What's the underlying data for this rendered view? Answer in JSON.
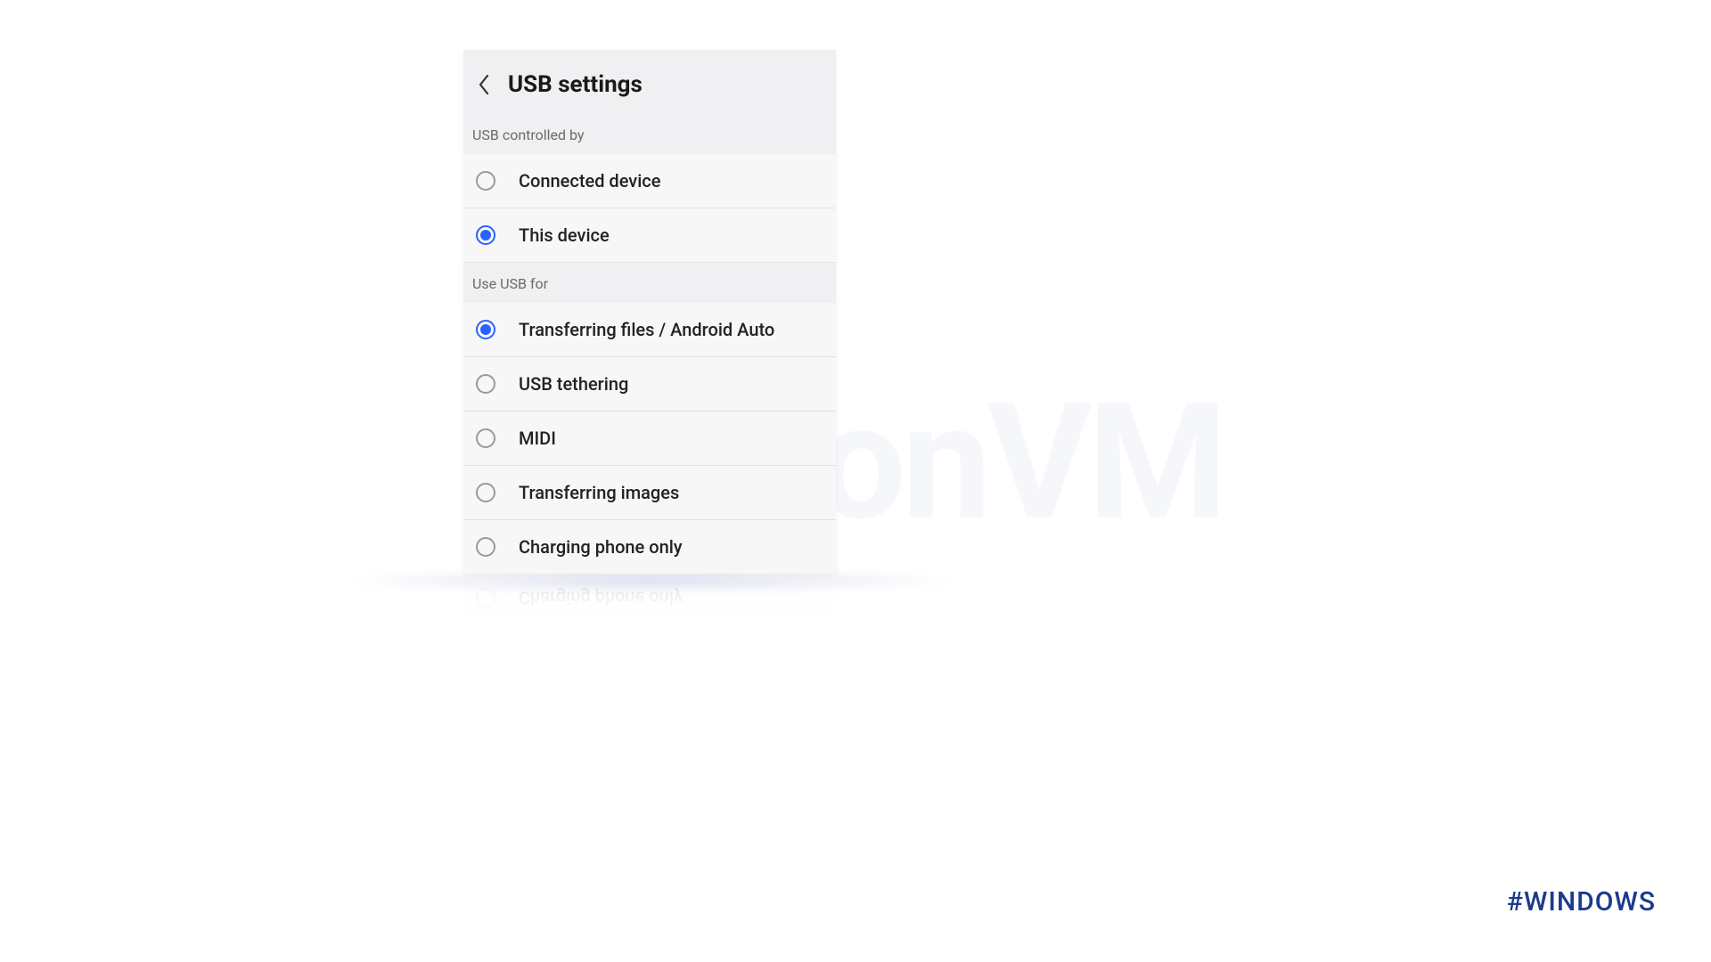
{
  "watermark_text": "NeuronVM",
  "hashtag": "#WINDOWS",
  "header": {
    "title": "USB settings"
  },
  "sections": {
    "controlled_by": {
      "label": "USB controlled by",
      "options": [
        {
          "label": "Connected device",
          "selected": false
        },
        {
          "label": "This device",
          "selected": true
        }
      ]
    },
    "use_for": {
      "label": "Use USB for",
      "options": [
        {
          "label": "Transferring files / Android Auto",
          "selected": true
        },
        {
          "label": "USB tethering",
          "selected": false
        },
        {
          "label": "MIDI",
          "selected": false
        },
        {
          "label": "Transferring images",
          "selected": false
        },
        {
          "label": "Charging phone only",
          "selected": false
        }
      ]
    }
  }
}
